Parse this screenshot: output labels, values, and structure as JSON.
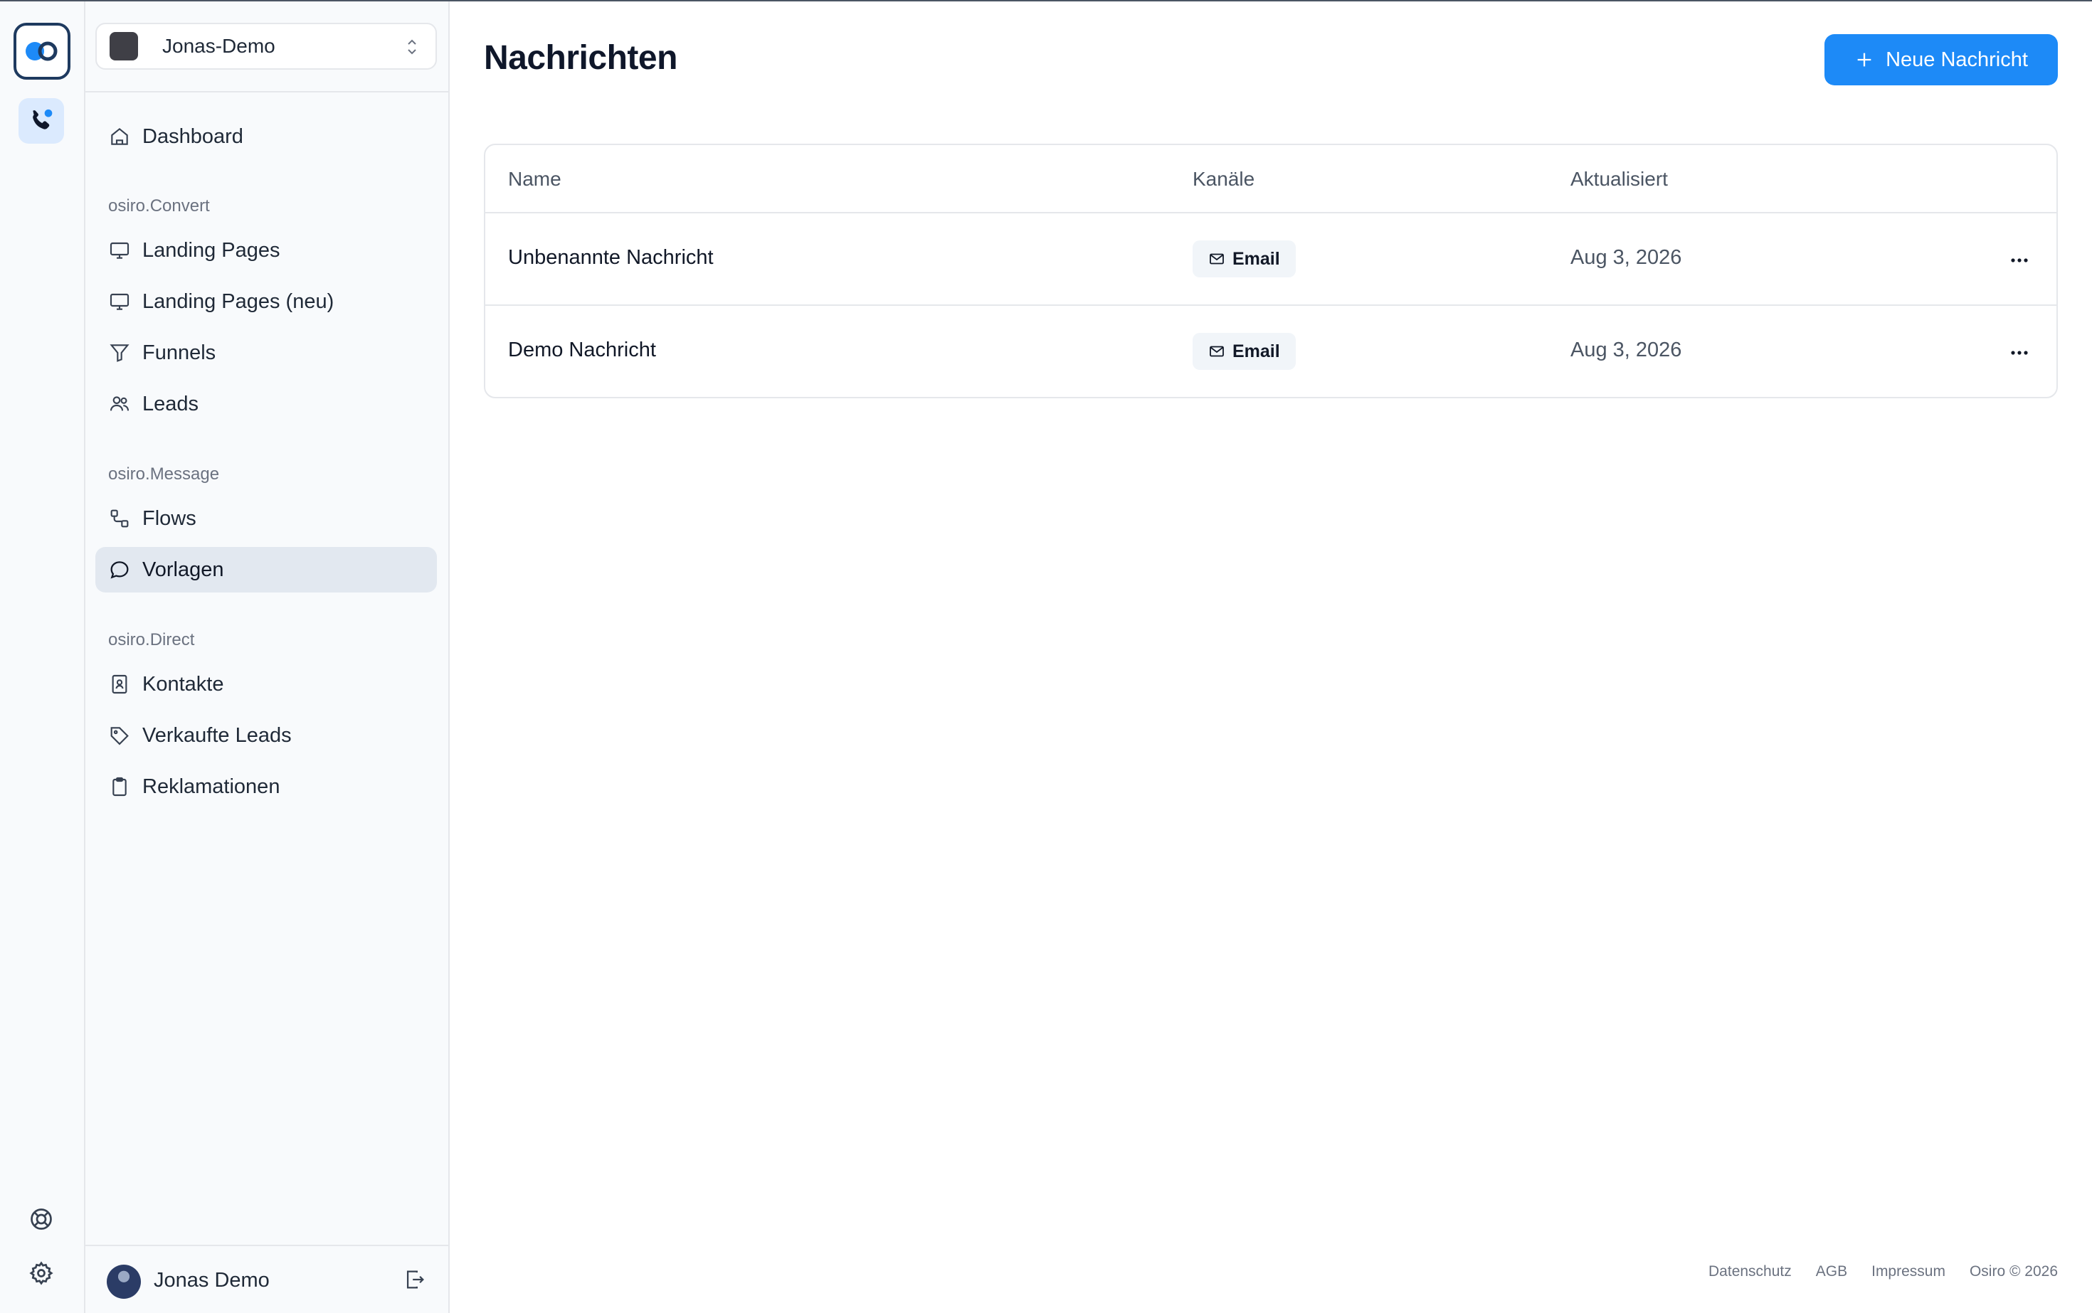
{
  "workspace": {
    "name": "Jonas-Demo"
  },
  "nav": {
    "dashboard": "Dashboard",
    "sections": [
      {
        "title": "osiro.Convert",
        "items": [
          "Landing Pages",
          "Landing Pages (neu)",
          "Funnels",
          "Leads"
        ]
      },
      {
        "title": "osiro.Message",
        "items": [
          "Flows",
          "Vorlagen"
        ]
      },
      {
        "title": "osiro.Direct",
        "items": [
          "Kontakte",
          "Verkaufte Leads",
          "Reklamationen"
        ]
      }
    ],
    "active": "Vorlagen"
  },
  "user": {
    "name": "Jonas Demo"
  },
  "page": {
    "title": "Nachrichten",
    "new_button": "Neue Nachricht"
  },
  "table": {
    "columns": [
      "Name",
      "Kanäle",
      "Aktualisiert"
    ],
    "rows": [
      {
        "name": "Unbenannte Nachricht",
        "channel": "Email",
        "updated": "Aug 3, 2026"
      },
      {
        "name": "Demo Nachricht",
        "channel": "Email",
        "updated": "Aug 3, 2026"
      }
    ]
  },
  "footer": {
    "privacy": "Datenschutz",
    "terms": "AGB",
    "imprint": "Impressum",
    "copyright": "Osiro © 2026"
  },
  "colors": {
    "primary": "#1d8af7",
    "active_nav": "#e2e8f0",
    "sidebar_bg": "#f8fafc",
    "logo_border": "#1e3a5f"
  }
}
